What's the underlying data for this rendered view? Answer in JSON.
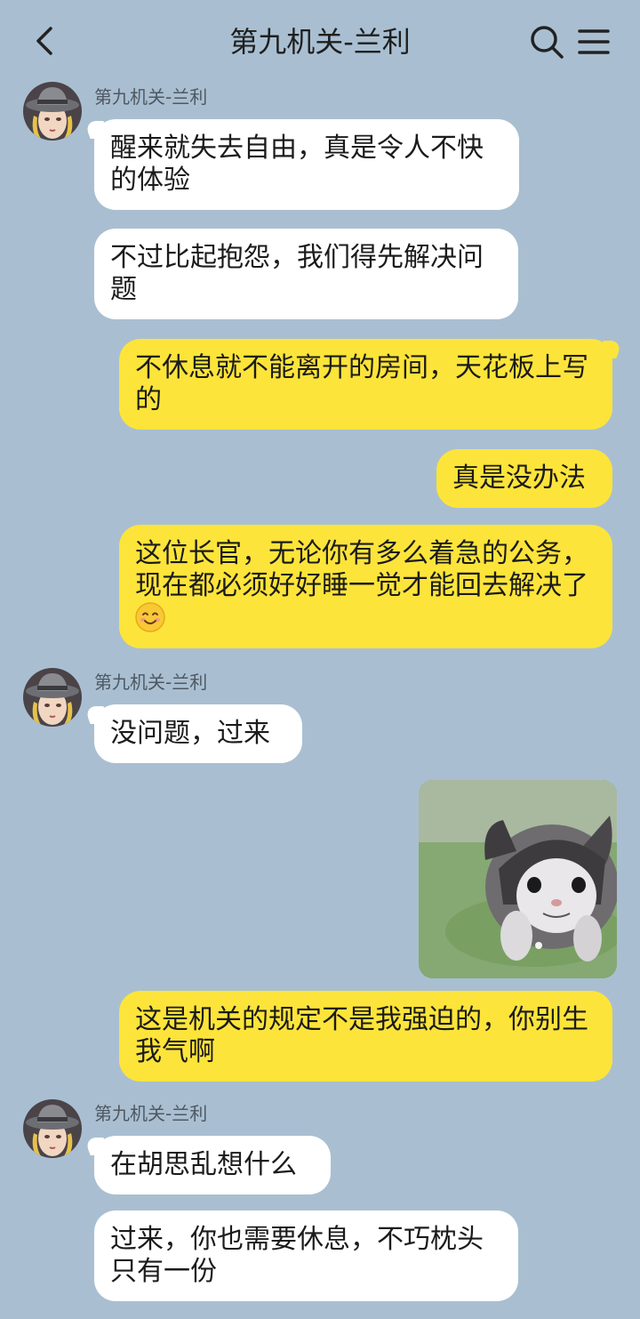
{
  "header": {
    "title": "第九机关-兰利"
  },
  "messages": [
    {
      "sender": "第九机关-兰利",
      "text": "醒来就失去自由，真是令人不快的体验"
    },
    {
      "text": "不过比起抱怨，我们得先解决问题"
    },
    {
      "text": "不休息就不能离开的房间，天花板上写的"
    },
    {
      "text": "真是没办法"
    },
    {
      "text": "这位长官，无论你有多么着急的公务，现在都必须好好睡一觉才能回去解决了"
    },
    {
      "sender": "第九机关-兰利",
      "text": "没问题，过来"
    },
    {
      "text": "这是机关的规定不是我强迫的，你别生我气啊"
    },
    {
      "sender": "第九机关-兰利",
      "text": "在胡思乱想什么"
    },
    {
      "text": "过来，你也需要休息，不巧枕头只有一份"
    }
  ],
  "colors": {
    "background": "#a9bfd1",
    "incoming_bubble": "#ffffff",
    "outgoing_bubble": "#fde43a"
  },
  "icons": {
    "back": "chevron-left-icon",
    "search": "search-icon",
    "menu": "menu-icon",
    "smile_emoji": "smiling-face-emoji"
  }
}
